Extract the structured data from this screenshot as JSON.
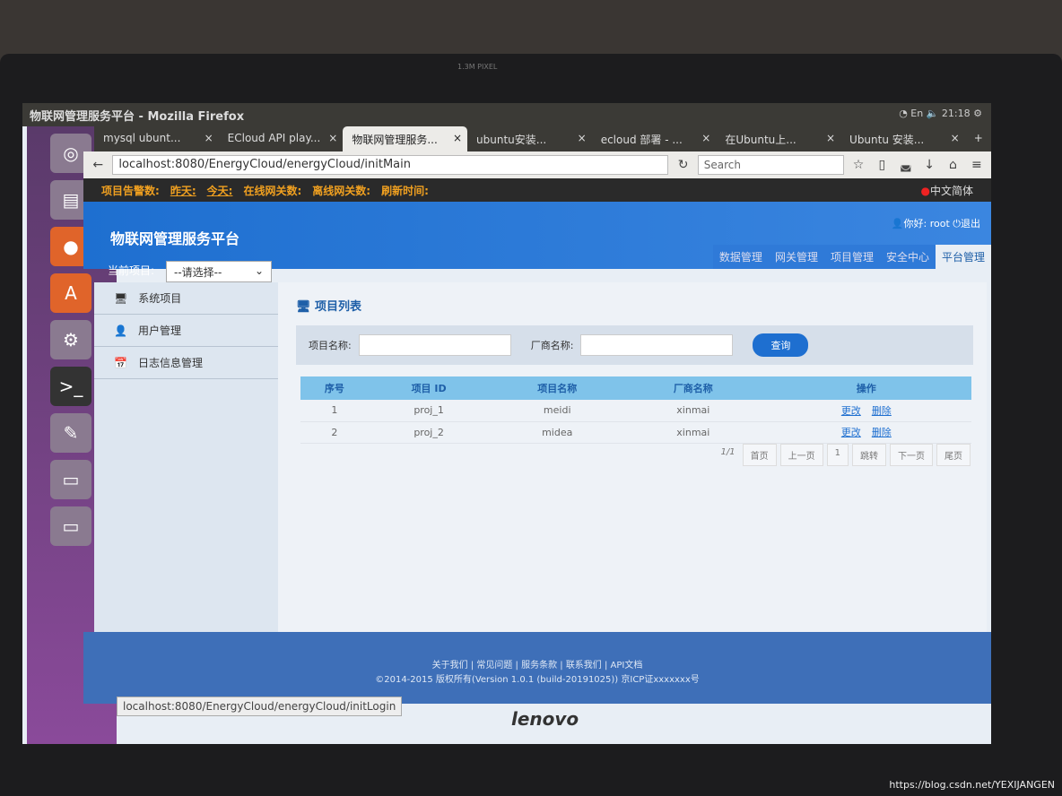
{
  "window": {
    "title": "物联网管理服务平台 - Mozilla Firefox",
    "clock": "21:18",
    "ime": "En"
  },
  "tabs": [
    {
      "label": "mysql ubunt..."
    },
    {
      "label": "ECloud API play..."
    },
    {
      "label": "物联网管理服务...",
      "active": true
    },
    {
      "label": "ubuntu安装..."
    },
    {
      "label": "ecloud 部署 - ..."
    },
    {
      "label": "在Ubuntu上..."
    },
    {
      "label": "Ubuntu 安装..."
    }
  ],
  "toolbar": {
    "url": "localhost:8080/EnergyCloud/energyCloud/initMain",
    "search_placeholder": "Search"
  },
  "infobar": {
    "alarms": "项目告警数:",
    "yesterday": "昨天:",
    "today": "今天:",
    "online": "在线网关数:",
    "offline": "离线网关数:",
    "refresh": "刷新时间:",
    "language": "中文简体"
  },
  "header": {
    "brand": "物联网管理服务平台",
    "greeting": "你好: root",
    "logout": "退出",
    "current_project_label": "当前项目:",
    "current_project_value": "--请选择--",
    "nav": [
      "数据管理",
      "网关管理",
      "项目管理",
      "安全中心",
      "平台管理"
    ],
    "active_nav": "平台管理"
  },
  "sidebar": {
    "items": [
      {
        "label": "系统项目",
        "icon": "monitor-icon"
      },
      {
        "label": "用户管理",
        "icon": "user-icon"
      },
      {
        "label": "日志信息管理",
        "icon": "calendar-icon"
      }
    ]
  },
  "main": {
    "title": "项目列表",
    "filter": {
      "project_label": "项目名称:",
      "vendor_label": "厂商名称:",
      "query_button": "查询"
    },
    "table": {
      "headers": [
        "序号",
        "项目 ID",
        "项目名称",
        "厂商名称",
        "操作"
      ],
      "rows": [
        {
          "no": "1",
          "id": "proj_1",
          "name": "meidi",
          "vendor": "xinmai",
          "edit": "更改",
          "delete": "删除"
        },
        {
          "no": "2",
          "id": "proj_2",
          "name": "midea",
          "vendor": "xinmai",
          "edit": "更改",
          "delete": "删除"
        }
      ]
    },
    "pager": {
      "info": "1/1",
      "first": "首页",
      "prev": "上一页",
      "page": "1",
      "jump": "跳转",
      "next": "下一页",
      "last": "尾页"
    }
  },
  "footer": {
    "links": [
      "关于我们",
      "常见问题",
      "服务条款",
      "联系我们",
      "API文档"
    ],
    "copyright": "©2014-2015 版权所有(Version 1.0.1 (build-20191025)) 京ICP证xxxxxxx号"
  },
  "status_url": "localhost:8080/EnergyCloud/energyCloud/initLogin",
  "hardware": {
    "camera": "1.3M PIXEL",
    "brand": "lenovo"
  },
  "watermark": "https://blog.csdn.net/YEXIJANGEN"
}
